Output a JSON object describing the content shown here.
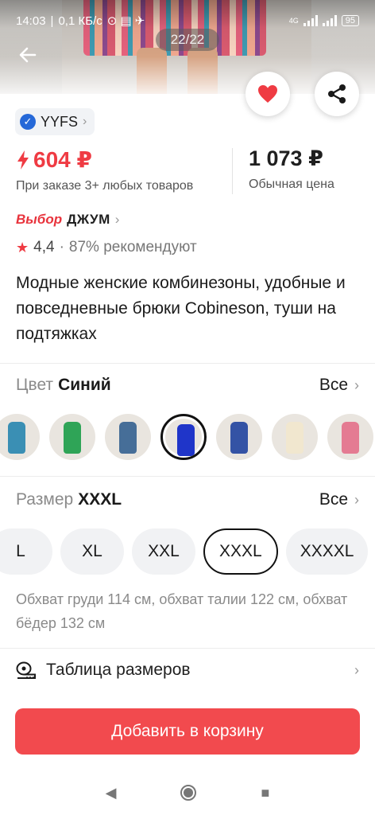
{
  "status": {
    "time": "14:03",
    "speed": "0,1 КБ/с",
    "network": "4G",
    "battery": "95"
  },
  "gallery": {
    "counter": "22/22"
  },
  "seller": {
    "name": "YYFS"
  },
  "price": {
    "promo": "604 ₽",
    "promo_note": "При заказе 3+ любых товаров",
    "regular": "1 073 ₽",
    "regular_note": "Обычная цена"
  },
  "choice": {
    "badge": "Выбор",
    "name": "ДЖУМ"
  },
  "rating": {
    "score": "4,4",
    "recommend": "87% рекомендуют"
  },
  "product": {
    "title": "Модные женские комбинезоны, удобные и повседневные брюки Cobineson, туши на подтяжках"
  },
  "color": {
    "label": "Цвет",
    "value": "Синий",
    "all_label": "Все",
    "swatches": [
      {
        "name": "teal",
        "color": "#3a8fb4"
      },
      {
        "name": "green",
        "color": "#2fa457"
      },
      {
        "name": "denim",
        "color": "#466e98"
      },
      {
        "name": "blue",
        "color": "#1f35c9"
      },
      {
        "name": "navy",
        "color": "#3453a5"
      },
      {
        "name": "cream",
        "color": "#f1e7cf"
      },
      {
        "name": "stripe",
        "color": "#e47b92"
      }
    ],
    "selected_index": 3
  },
  "size": {
    "label": "Размер",
    "value": "XXXL",
    "all_label": "Все",
    "options": [
      "L",
      "XL",
      "XXL",
      "XXXL",
      "XXXXL"
    ],
    "selected_index": 3,
    "note": "Обхват груди 114 см, обхват талии 122 см, обхват бёдер 132 см"
  },
  "size_table": {
    "label": "Таблица размеров"
  },
  "cart": {
    "label": "Добавить в корзину"
  },
  "colors": {
    "accent": "#f24a4e",
    "price_red": "#ef3b43",
    "verified_blue": "#2568d8"
  }
}
